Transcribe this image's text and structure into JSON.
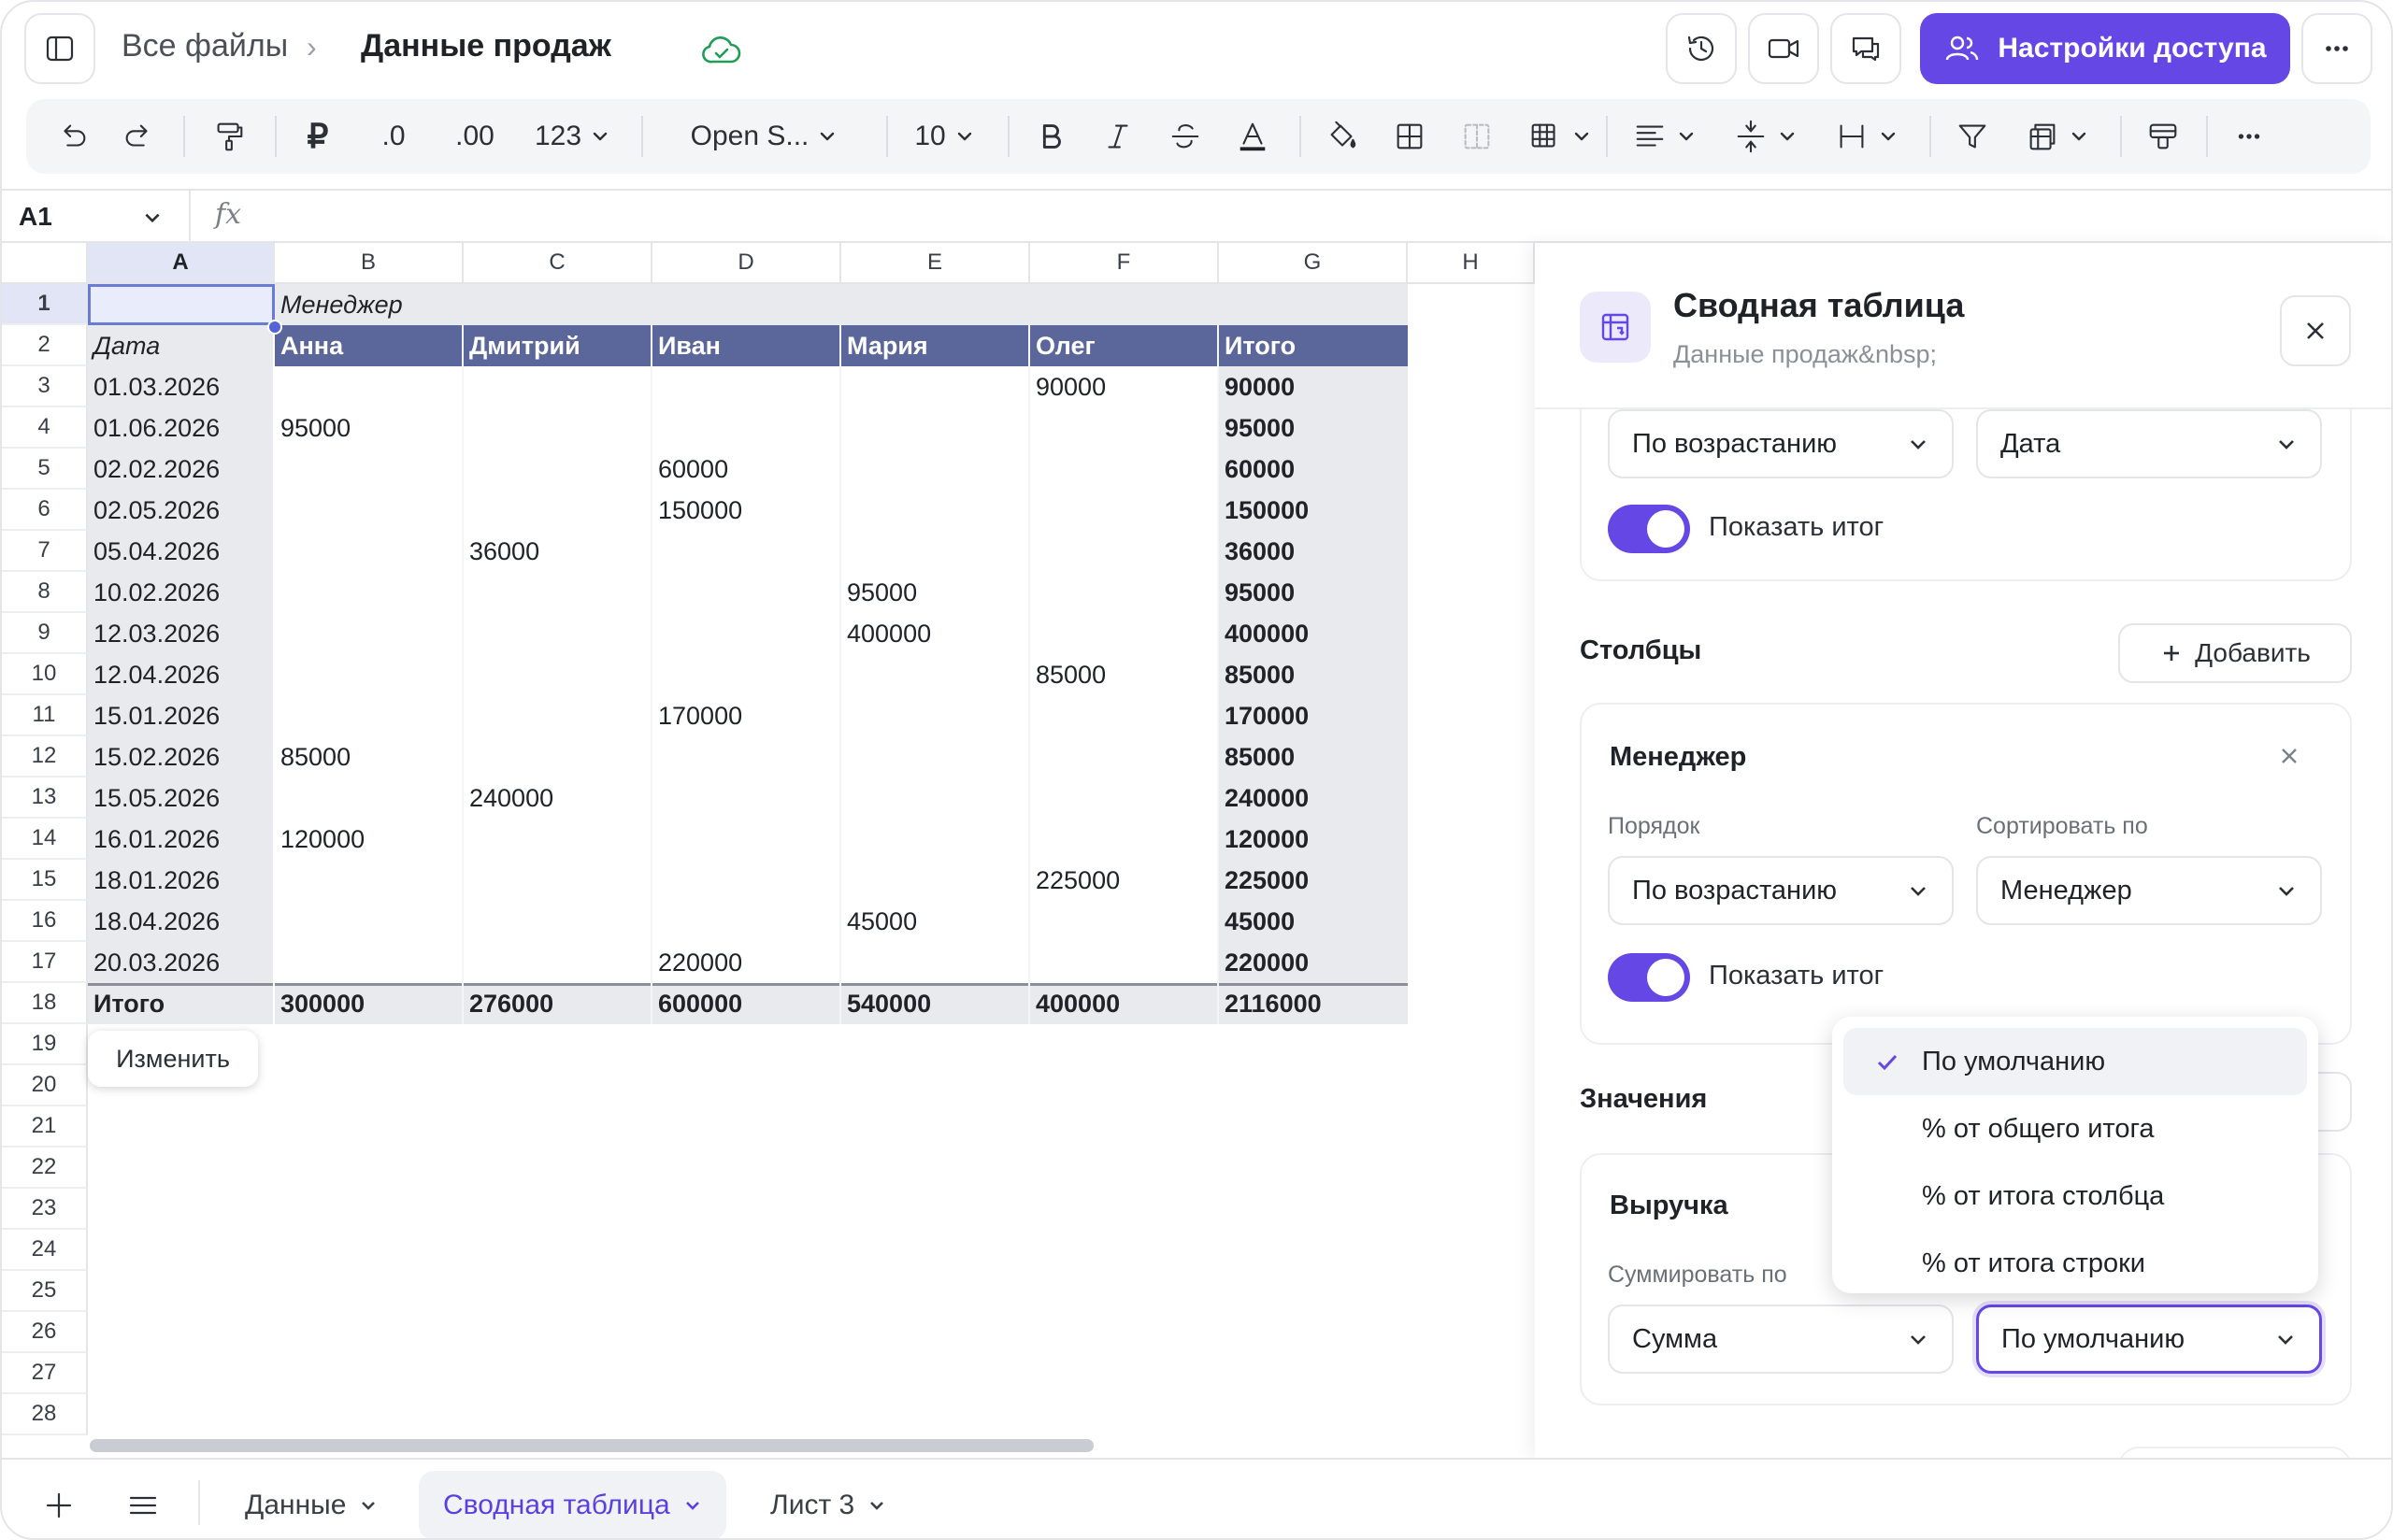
{
  "breadcrumb": {
    "root": "Все файлы",
    "current": "Данные продаж"
  },
  "header": {
    "share_label": "Настройки доступа"
  },
  "toolbar": {
    "decimal_decrease": ".0",
    "decimal_increase": ".00",
    "number_format": "123",
    "font": "Open S...",
    "font_size": "10"
  },
  "formula": {
    "cell_ref": "A1",
    "fx": "fx"
  },
  "columns": [
    "A",
    "B",
    "C",
    "D",
    "E",
    "F",
    "G",
    "H"
  ],
  "rows": [
    "1",
    "2",
    "3",
    "4",
    "5",
    "6",
    "7",
    "8",
    "9",
    "10",
    "11",
    "12",
    "13",
    "14",
    "15",
    "16",
    "17",
    "18",
    "19",
    "20",
    "21",
    "22",
    "23",
    "24",
    "25",
    "26",
    "27",
    "28"
  ],
  "pivot": {
    "columns_field_label": "Менеджер",
    "rows_field_label": "Дата",
    "headers": [
      "Анна",
      "Дмитрий",
      "Иван",
      "Мария",
      "Олег",
      "Итого"
    ],
    "body": [
      [
        "01.03.2026",
        "",
        "",
        "",
        "",
        "90000",
        "90000"
      ],
      [
        "01.06.2026",
        "95000",
        "",
        "",
        "",
        "",
        "95000"
      ],
      [
        "02.02.2026",
        "",
        "",
        "60000",
        "",
        "",
        "60000"
      ],
      [
        "02.05.2026",
        "",
        "",
        "150000",
        "",
        "",
        "150000"
      ],
      [
        "05.04.2026",
        "",
        "36000",
        "",
        "",
        "",
        "36000"
      ],
      [
        "10.02.2026",
        "",
        "",
        "",
        "95000",
        "",
        "95000"
      ],
      [
        "12.03.2026",
        "",
        "",
        "",
        "400000",
        "",
        "400000"
      ],
      [
        "12.04.2026",
        "",
        "",
        "",
        "",
        "85000",
        "85000"
      ],
      [
        "15.01.2026",
        "",
        "",
        "170000",
        "",
        "",
        "170000"
      ],
      [
        "15.02.2026",
        "85000",
        "",
        "",
        "",
        "",
        "85000"
      ],
      [
        "15.05.2026",
        "",
        "240000",
        "",
        "",
        "",
        "240000"
      ],
      [
        "16.01.2026",
        "120000",
        "",
        "",
        "",
        "",
        "120000"
      ],
      [
        "18.01.2026",
        "",
        "",
        "",
        "",
        "225000",
        "225000"
      ],
      [
        "18.04.2026",
        "",
        "",
        "",
        "45000",
        "",
        "45000"
      ],
      [
        "20.03.2026",
        "",
        "",
        "220000",
        "",
        "",
        "220000"
      ]
    ],
    "total_row": [
      "Итого",
      "300000",
      "276000",
      "600000",
      "540000",
      "400000",
      "2116000"
    ]
  },
  "edit_button": "Изменить",
  "sheets": [
    {
      "label": "Данные"
    },
    {
      "label": "Сводная таблица"
    },
    {
      "label": "Лист 3"
    }
  ],
  "panel": {
    "title": "Сводная таблица",
    "subtitle": "Данные продаж&nbsp;",
    "rows_section": {
      "order": "По возрастанию",
      "sort_by": "Дата",
      "show_total": "Показать итог"
    },
    "columns_section": {
      "title": "Столбцы",
      "add_label": "Добавить",
      "field": "Менеджер",
      "order_label": "Порядок",
      "sort_label": "Сортировать по",
      "order": "По возрастанию",
      "sort_by": "Менеджер",
      "show_total": "Показать итог"
    },
    "values_section": {
      "title": "Значения",
      "field": "Выручка",
      "summarize_label": "Суммировать по",
      "summarize": "Сумма",
      "show_as": "По умолчанию"
    }
  },
  "dropdown": {
    "options": [
      "По умолчанию",
      "% от общего итога",
      "% от итога столбца",
      "% от итога строки"
    ],
    "selected": "По умолчанию"
  },
  "colors": {
    "accent": "#6547e6",
    "pivot_header": "#5b679a",
    "pivot_band": "#e9eaee",
    "cloud_ok": "#1f9d55"
  }
}
